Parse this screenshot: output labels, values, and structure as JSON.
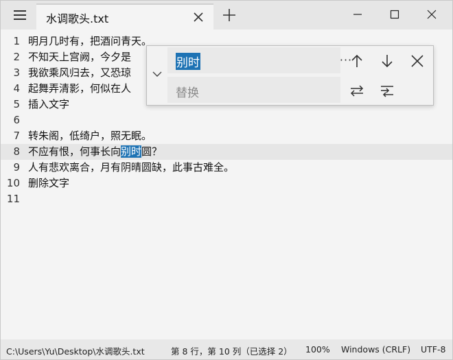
{
  "tab": {
    "title": "水调歌头.txt"
  },
  "window": {
    "minimize_icon": "minimize-icon",
    "maximize_icon": "maximize-icon",
    "close_icon": "close-icon"
  },
  "editor": {
    "lines": [
      {
        "num": "1",
        "text": "明月几时有，把酒问青天。"
      },
      {
        "num": "2",
        "text": "不知天上宫阙，今夕是"
      },
      {
        "num": "3",
        "text": "我欲乘风归去，又恐琼"
      },
      {
        "num": "4",
        "text": "起舞弄清影，何似在人"
      },
      {
        "num": "5",
        "text": "插入文字"
      },
      {
        "num": "6",
        "text": ""
      },
      {
        "num": "7",
        "text": "转朱阁，低绮户，照无眠。"
      },
      {
        "num": "8",
        "before": "不应有恨，何事长向",
        "match": "别时",
        "after": "圆？"
      },
      {
        "num": "9",
        "text": "人有悲欢离合，月有阴晴圆缺，此事古难全。"
      },
      {
        "num": "10",
        "text": "删除文字"
      },
      {
        "num": "11",
        "text": ""
      }
    ],
    "current_line": 8
  },
  "find": {
    "query": "别时",
    "replace_placeholder": "替换",
    "more_label": "···"
  },
  "status": {
    "path": "C:\\Users\\Yu\\Desktop\\水调歌头.txt",
    "position": "第 8 行，第 10 列（已选择 2）",
    "zoom": "100%",
    "eol": "Windows (CRLF)",
    "encoding": "UTF-8"
  },
  "colors": {
    "selection": "#1e73b4",
    "current_line": "#e6e6e6",
    "background": "#f4f4f4"
  }
}
